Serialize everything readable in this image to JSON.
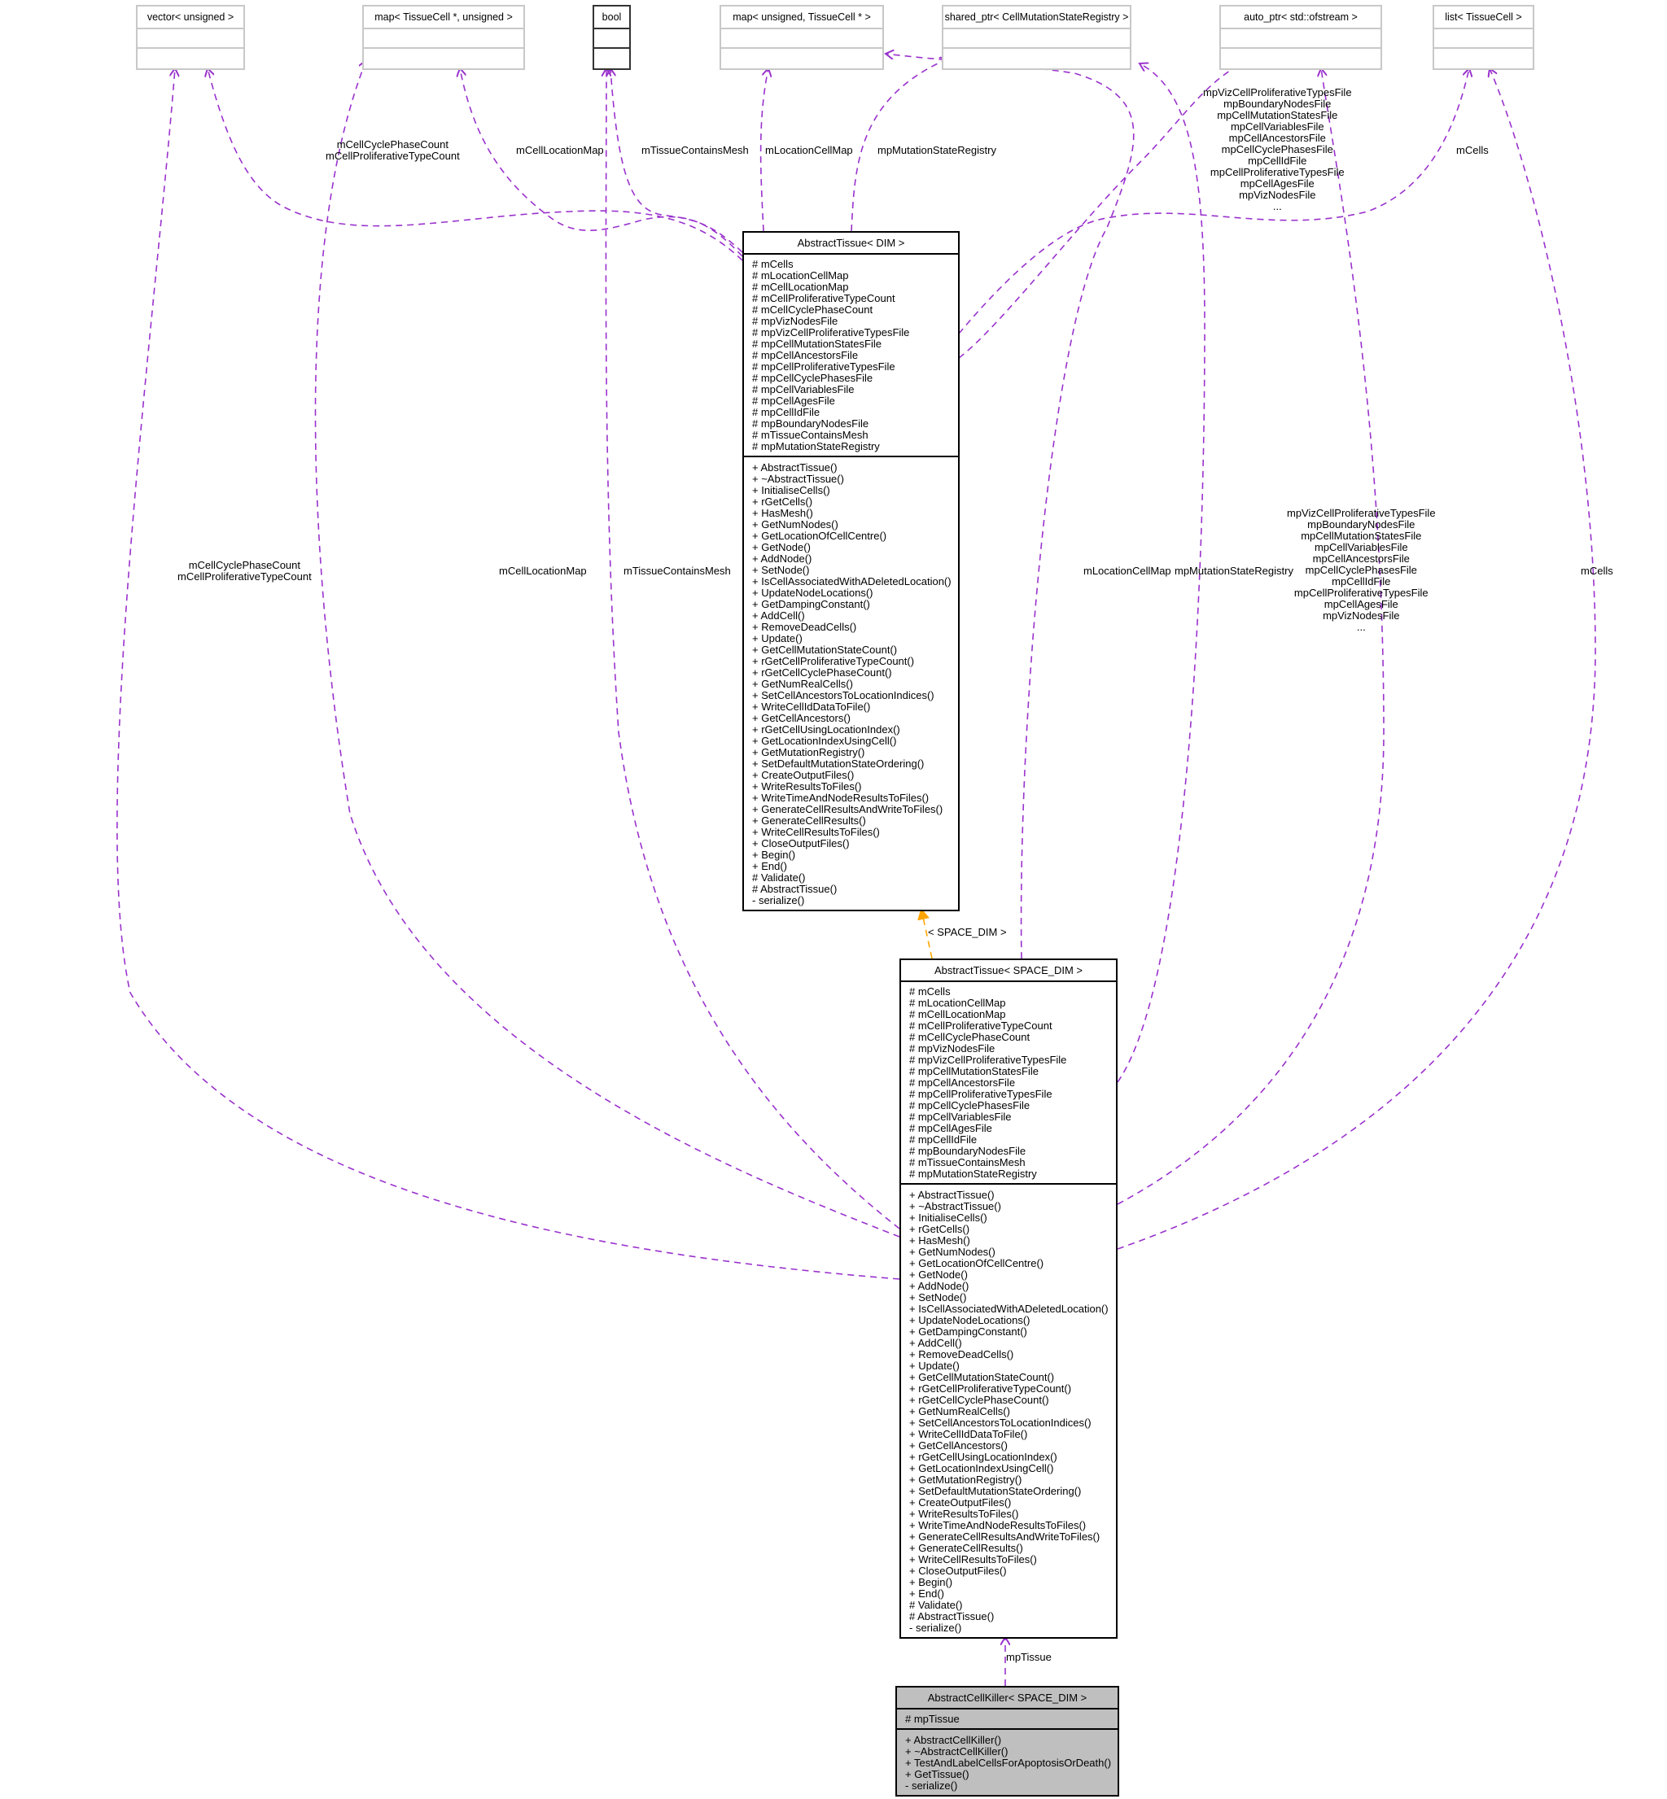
{
  "colors": {
    "usage_edge": "#9a32cd",
    "inherit_edge": "#ffa500",
    "external_border": "#c8c8c8",
    "focus_node_fill": "#bfbfbf"
  },
  "external_types": [
    {
      "id": "vector",
      "name": "vector< unsigned >"
    },
    {
      "id": "map_cell_unsigned",
      "name": "map< TissueCell *, unsigned >"
    },
    {
      "id": "bool",
      "name": "bool"
    },
    {
      "id": "map_unsigned_cell",
      "name": "map< unsigned, TissueCell * >"
    },
    {
      "id": "shared_ptr",
      "name": "shared_ptr< CellMutationStateRegistry >"
    },
    {
      "id": "auto_ptr",
      "name": "auto_ptr< std::ofstream >"
    },
    {
      "id": "list",
      "name": "list< TissueCell >"
    }
  ],
  "abstract_tissue_dim": {
    "title": "AbstractTissue< DIM >",
    "attributes": [
      "# mCells",
      "# mLocationCellMap",
      "# mCellLocationMap",
      "# mCellProliferativeTypeCount",
      "# mCellCyclePhaseCount",
      "# mpVizNodesFile",
      "# mpVizCellProliferativeTypesFile",
      "# mpCellMutationStatesFile",
      "# mpCellAncestorsFile",
      "# mpCellProliferativeTypesFile",
      "# mpCellCyclePhasesFile",
      "# mpCellVariablesFile",
      "# mpCellAgesFile",
      "# mpCellIdFile",
      "# mpBoundaryNodesFile",
      "# mTissueContainsMesh",
      "# mpMutationStateRegistry"
    ],
    "methods": [
      "+ AbstractTissue()",
      "+ ~AbstractTissue()",
      "+ InitialiseCells()",
      "+ rGetCells()",
      "+ HasMesh()",
      "+ GetNumNodes()",
      "+ GetLocationOfCellCentre()",
      "+ GetNode()",
      "+ AddNode()",
      "+ SetNode()",
      "+ IsCellAssociatedWithADeletedLocation()",
      "+ UpdateNodeLocations()",
      "+ GetDampingConstant()",
      "+ AddCell()",
      "+ RemoveDeadCells()",
      "+ Update()",
      "+ GetCellMutationStateCount()",
      "+ rGetCellProliferativeTypeCount()",
      "+ rGetCellCyclePhaseCount()",
      "+ GetNumRealCells()",
      "+ SetCellAncestorsToLocationIndices()",
      "+ WriteCellIdDataToFile()",
      "+ GetCellAncestors()",
      "+ rGetCellUsingLocationIndex()",
      "+ GetLocationIndexUsingCell()",
      "+ GetMutationRegistry()",
      "+ SetDefaultMutationStateOrdering()",
      "+ CreateOutputFiles()",
      "+ WriteResultsToFiles()",
      "+ WriteTimeAndNodeResultsToFiles()",
      "+ GenerateCellResultsAndWriteToFiles()",
      "+ GenerateCellResults()",
      "+ WriteCellResultsToFiles()",
      "+ CloseOutputFiles()",
      "+ Begin()",
      "+ End()",
      "# Validate()",
      "# AbstractTissue()",
      "- serialize()"
    ]
  },
  "abstract_tissue_space_dim": {
    "title": "AbstractTissue< SPACE_DIM >",
    "attributes": [
      "# mCells",
      "# mLocationCellMap",
      "# mCellLocationMap",
      "# mCellProliferativeTypeCount",
      "# mCellCyclePhaseCount",
      "# mpVizNodesFile",
      "# mpVizCellProliferativeTypesFile",
      "# mpCellMutationStatesFile",
      "# mpCellAncestorsFile",
      "# mpCellProliferativeTypesFile",
      "# mpCellCyclePhasesFile",
      "# mpCellVariablesFile",
      "# mpCellAgesFile",
      "# mpCellIdFile",
      "# mpBoundaryNodesFile",
      "# mTissueContainsMesh",
      "# mpMutationStateRegistry"
    ],
    "methods": [
      "+ AbstractTissue()",
      "+ ~AbstractTissue()",
      "+ InitialiseCells()",
      "+ rGetCells()",
      "+ HasMesh()",
      "+ GetNumNodes()",
      "+ GetLocationOfCellCentre()",
      "+ GetNode()",
      "+ AddNode()",
      "+ SetNode()",
      "+ IsCellAssociatedWithADeletedLocation()",
      "+ UpdateNodeLocations()",
      "+ GetDampingConstant()",
      "+ AddCell()",
      "+ RemoveDeadCells()",
      "+ Update()",
      "+ GetCellMutationStateCount()",
      "+ rGetCellProliferativeTypeCount()",
      "+ rGetCellCyclePhaseCount()",
      "+ GetNumRealCells()",
      "+ SetCellAncestorsToLocationIndices()",
      "+ WriteCellIdDataToFile()",
      "+ GetCellAncestors()",
      "+ rGetCellUsingLocationIndex()",
      "+ GetLocationIndexUsingCell()",
      "+ GetMutationRegistry()",
      "+ SetDefaultMutationStateOrdering()",
      "+ CreateOutputFiles()",
      "+ WriteResultsToFiles()",
      "+ WriteTimeAndNodeResultsToFiles()",
      "+ GenerateCellResultsAndWriteToFiles()",
      "+ GenerateCellResults()",
      "+ WriteCellResultsToFiles()",
      "+ CloseOutputFiles()",
      "+ Begin()",
      "+ End()",
      "# Validate()",
      "# AbstractTissue()",
      "- serialize()"
    ]
  },
  "abstract_cell_killer": {
    "title": "AbstractCellKiller< SPACE_DIM >",
    "attributes": [
      "# mpTissue"
    ],
    "methods": [
      "+ AbstractCellKiller()",
      "+ ~AbstractCellKiller()",
      "+ TestAndLabelCellsForApoptosisOrDeath()",
      "+ GetTissue()",
      "- serialize()"
    ]
  },
  "edge_labels": {
    "upper": {
      "cycle_prolif_count": [
        "mCellCyclePhaseCount",
        "mCellProliferativeTypeCount"
      ],
      "cell_location_map": [
        "mCellLocationMap"
      ],
      "tissue_contains_mesh": [
        "mTissueContainsMesh"
      ],
      "location_cell_map": [
        "mLocationCellMap"
      ],
      "mutation_state_registry": [
        "mpMutationStateRegistry"
      ],
      "files": [
        "mpVizCellProliferativeTypesFile",
        "mpBoundaryNodesFile",
        "mpCellMutationStatesFile",
        "mpCellVariablesFile",
        "mpCellAncestorsFile",
        "mpCellCyclePhasesFile",
        "mpCellIdFile",
        "mpCellProliferativeTypesFile",
        "mpCellAgesFile",
        "mpVizNodesFile",
        "..."
      ],
      "cells": [
        "mCells"
      ]
    },
    "lower": {
      "cycle_prolif_count": [
        "mCellCyclePhaseCount",
        "mCellProliferativeTypeCount"
      ],
      "cell_location_map": [
        "mCellLocationMap"
      ],
      "tissue_contains_mesh": [
        "mTissueContainsMesh"
      ],
      "location_cell_map": [
        "mLocationCellMap"
      ],
      "mutation_state_registry": [
        "mpMutationStateRegistry"
      ],
      "files": [
        "mpVizCellProliferativeTypesFile",
        "mpBoundaryNodesFile",
        "mpCellMutationStatesFile",
        "mpCellVariablesFile",
        "mpCellAncestorsFile",
        "mpCellCyclePhasesFile",
        "mpCellIdFile",
        "mpCellProliferativeTypesFile",
        "mpCellAgesFile",
        "mpVizNodesFile",
        "..."
      ],
      "cells": [
        "mCells"
      ]
    },
    "template_instantiation": "< SPACE_DIM >",
    "mp_tissue": "mpTissue"
  }
}
